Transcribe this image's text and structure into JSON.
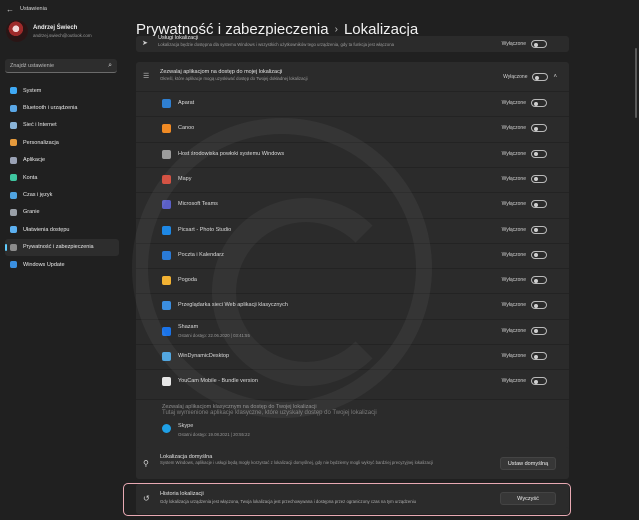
{
  "window": {
    "title": "Ustawienia",
    "back_glyph": "←"
  },
  "profile": {
    "name": "Andrzej Świech",
    "email": "andrzej.swiech@outlook.com"
  },
  "search": {
    "placeholder": "Znajdź ustawienie",
    "icon": "search-icon"
  },
  "nav": [
    {
      "label": "System",
      "color": "#3fa9f5",
      "icon": "system-icon"
    },
    {
      "label": "Bluetooth i urządzenia",
      "color": "#5aa7e6",
      "icon": "bluetooth-icon"
    },
    {
      "label": "Sieć i Internet",
      "color": "#8ab4d8",
      "icon": "network-icon"
    },
    {
      "label": "Personalizacja",
      "color": "#e59a3c",
      "icon": "brush-icon"
    },
    {
      "label": "Aplikacje",
      "color": "#9aa2b5",
      "icon": "apps-icon"
    },
    {
      "label": "Konta",
      "color": "#3fc6a0",
      "icon": "account-icon"
    },
    {
      "label": "Czas i język",
      "color": "#4fa3e0",
      "icon": "clock-icon"
    },
    {
      "label": "Granie",
      "color": "#9aa0a8",
      "icon": "gaming-icon"
    },
    {
      "label": "Ułatwienia dostępu",
      "color": "#5cb0f0",
      "icon": "accessibility-icon"
    },
    {
      "label": "Prywatność i zabezpieczenia",
      "color": "#8c8c8c",
      "icon": "shield-icon",
      "active": true
    },
    {
      "label": "Windows Update",
      "color": "#3a8fe0",
      "icon": "update-icon"
    }
  ],
  "breadcrumb": {
    "parent": "Prywatność i zabezpieczenia",
    "separator": "›",
    "current": "Lokalizacja"
  },
  "top_row": {
    "title": "Usługi lokalizacji",
    "subtitle": "Lokalizacja będzie dostępna dla systemu Windows i wszystkich użytkowników tego urządzenia, gdy ta funkcja jest włączona",
    "state": "Wyłączone"
  },
  "apps_header": {
    "title": "Zezwalaj aplikacjom na dostęp do mojej lokalizacji",
    "subtitle": "Określ, które aplikacje mogą uzyskiwać dostęp do Twojej dokładnej lokalizacji",
    "state": "Wyłączone"
  },
  "apps": [
    {
      "name": "Aparat",
      "state": "Wyłączone",
      "color": "#2f7fd1"
    },
    {
      "name": "Canoo",
      "state": "Wyłączone",
      "color": "#f08a24"
    },
    {
      "name": "Host środowiska powłoki systemu Windows",
      "state": "Wyłączone",
      "color": "#9c9c9c"
    },
    {
      "name": "Mapy",
      "state": "Wyłączone",
      "color": "#d24a3a"
    },
    {
      "name": "Microsoft Teams",
      "state": "Wyłączone",
      "color": "#5b5fc7"
    },
    {
      "name": "Picsart - Photo Studio",
      "state": "Wyłączone",
      "color": "#1e88e5"
    },
    {
      "name": "Poczta i Kalendarz",
      "state": "Wyłączone",
      "color": "#2a7ad6"
    },
    {
      "name": "Pogoda",
      "state": "Wyłączone",
      "color": "#f2b233"
    },
    {
      "name": "Przeglądarka sieci Web aplikacji klasycznych",
      "state": "Wyłączone",
      "color": "#3b8ee0"
    },
    {
      "name": "Shazam",
      "sub": "Ostatni dostęp: 22.06.2020 | 03:41:55",
      "state": "Wyłączone",
      "color": "#1a73e8"
    },
    {
      "name": "WinDynamicDesktop",
      "state": "Wyłączone",
      "color": "#4aa3df"
    },
    {
      "name": "YouCam Mobile - Bundle version",
      "state": "Wyłączone",
      "color": "#e7e7e7"
    }
  ],
  "classic": {
    "title": "Zezwalaj aplikacjom klasycznym na dostęp do Twojej lokalizacji",
    "subtitle": "Tutaj wymienione aplikacje klasyczne, które uzyskały dostęp do Twojej lokalizacji",
    "app": {
      "name": "Skype",
      "sub": "Ostatni dostęp: 19.08.2021 | 20:55:22",
      "color": "#1fa0e6"
    }
  },
  "default_location": {
    "title": "Lokalizacja domyślna",
    "subtitle": "System Windows, aplikacje i usługi będą mogły korzystać z lokalizacji domyślnej, gdy nie będziemy mogli wykryć bardziej precyzyjnej lokalizacji",
    "button": "Ustaw domyślną"
  },
  "history": {
    "title": "Historia lokalizacji",
    "subtitle": "Gdy lokalizacja urządzenia jest włączona, Twoja lokalizacja jest przechowywana i dostępna przez ograniczony czas na tym urządzeniu",
    "button": "Wyczyść"
  }
}
